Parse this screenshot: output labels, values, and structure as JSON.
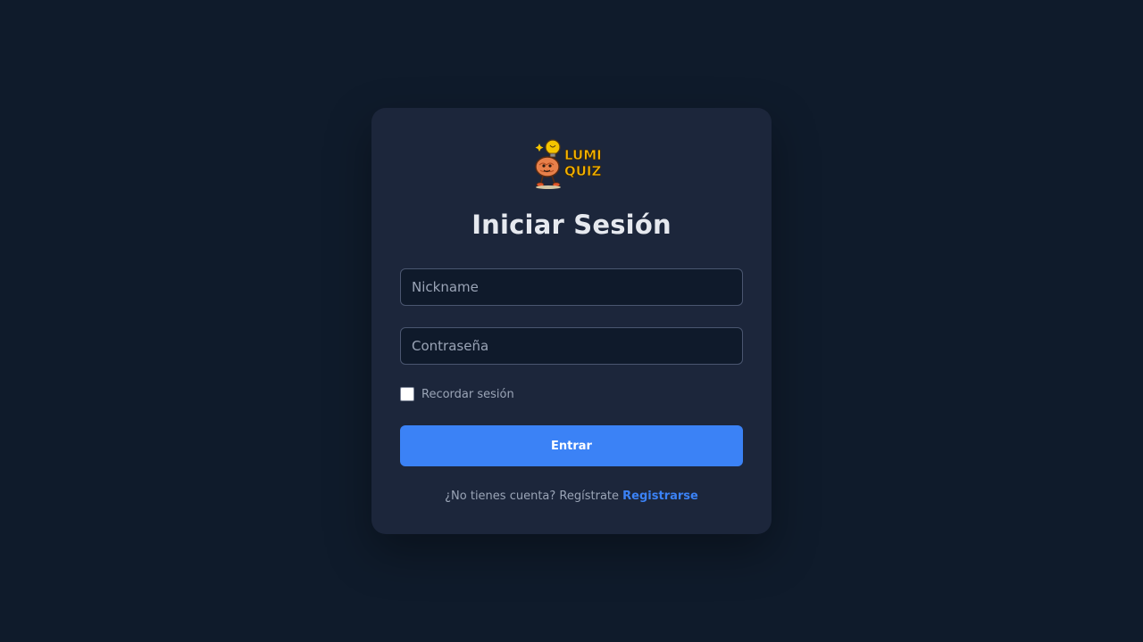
{
  "logo": {
    "line1": "LUMI",
    "line2": "QUIZ",
    "mascot_icon": "brain-lightbulb-mascot-icon",
    "colors": {
      "text": "#f5b400",
      "brain": "#e8804a",
      "bulb": "#f5c400"
    }
  },
  "title": "Iniciar Sesión",
  "form": {
    "nickname_placeholder": "Nickname",
    "password_placeholder": "Contraseña",
    "remember_label": "Recordar sesión",
    "remember_checked": false,
    "submit_label": "Entrar"
  },
  "footer": {
    "prompt": "¿No tienes cuenta? Regístrate",
    "register_link": "Registrarse"
  },
  "colors": {
    "background": "#0f1b2b",
    "card": "#1c263b",
    "accent": "#3b82f6"
  }
}
